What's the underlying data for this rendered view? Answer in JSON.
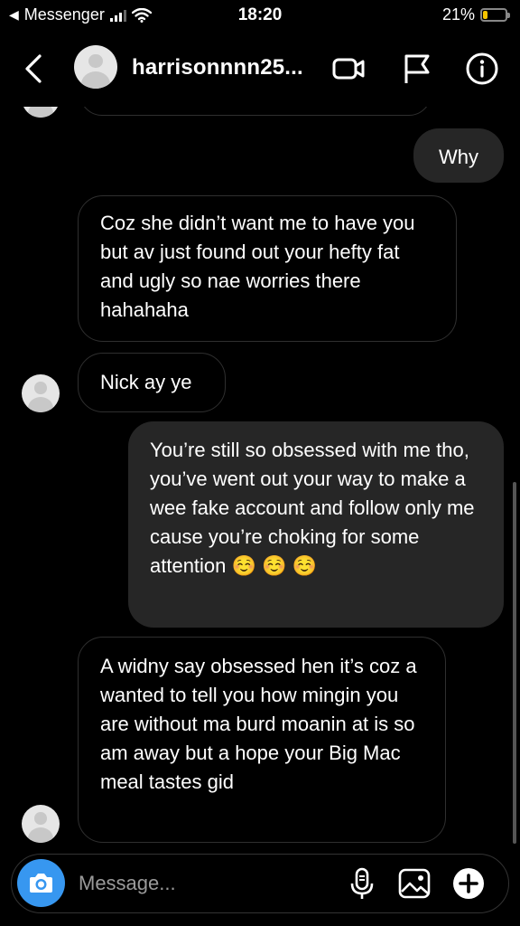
{
  "status_bar": {
    "back_app": "Messenger",
    "time": "18:20",
    "battery_percent_label": "21%",
    "battery_level": 0.21
  },
  "header": {
    "username": "harrisonnnn25..."
  },
  "messages": [
    {
      "from": "me",
      "text": "Why"
    },
    {
      "from": "them",
      "text": "Coz she didn’t want me to have you but av just found out your hefty fat and ugly so nae worries there hahahaha"
    },
    {
      "from": "them",
      "text": "Nick ay ye"
    },
    {
      "from": "me",
      "text": "You’re still so obsessed with me tho, you’ve went out your way to make a wee fake account and follow only me cause you’re choking for some attention ☺️ ☺️ ☺️"
    },
    {
      "from": "them",
      "text": "A widny say obsessed hen it’s coz a wanted to tell you how mingin you are without ma burd moanin at is so am away but a hope your Big Mac meal tastes gid"
    }
  ],
  "composer": {
    "placeholder": "Message..."
  },
  "colors": {
    "background": "#000000",
    "outgoing_bubble": "#262626",
    "camera_button": "#3797f0"
  }
}
